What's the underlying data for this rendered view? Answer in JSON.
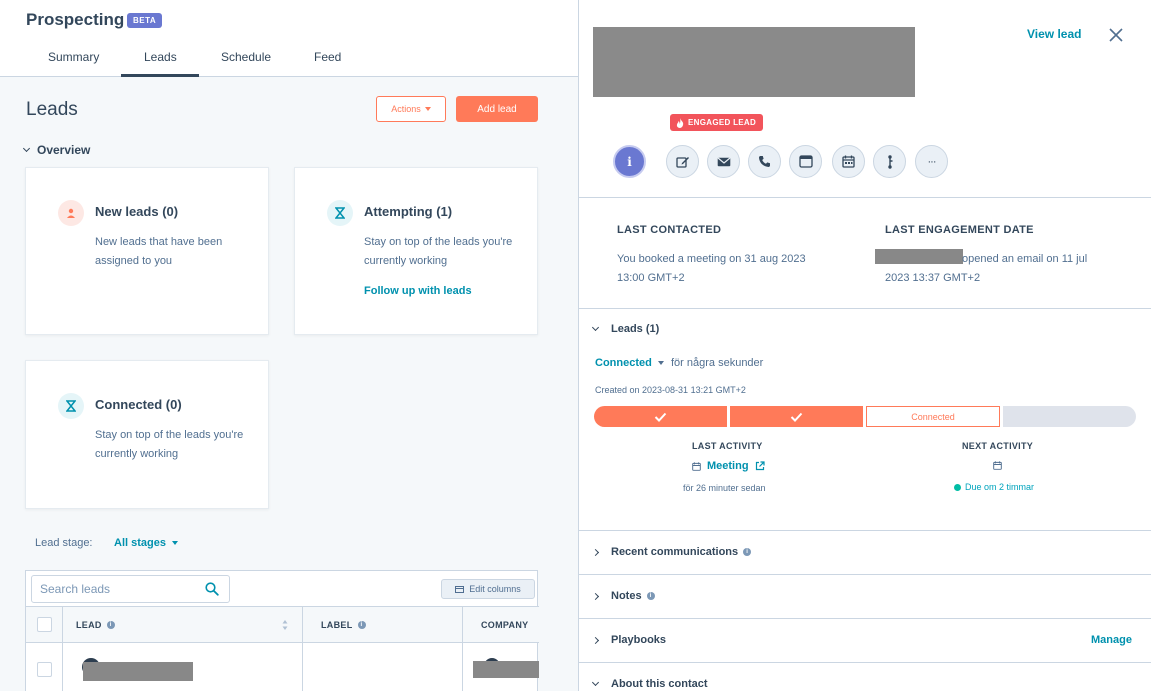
{
  "app": {
    "title": "Prospecting",
    "badge": "BETA"
  },
  "tabs": [
    {
      "label": "Summary"
    },
    {
      "label": "Leads"
    },
    {
      "label": "Schedule"
    },
    {
      "label": "Feed"
    }
  ],
  "leads_page": {
    "heading": "Leads",
    "actions_label": "Actions",
    "add_lead_label": "Add lead",
    "overview_label": "Overview",
    "cards": [
      {
        "title": "New leads (0)",
        "desc": "New leads that have been assigned to you",
        "link": ""
      },
      {
        "title": "Attempting (1)",
        "desc": "Stay on top of the leads you're currently working",
        "link": "Follow up with leads"
      },
      {
        "title": "Connected (0)",
        "desc": "Stay on top of the leads you're currently working",
        "link": ""
      }
    ],
    "lead_stage_label": "Lead stage:",
    "lead_stage_value": "All stages",
    "search_placeholder": "Search leads",
    "edit_columns_label": "Edit columns",
    "columns": {
      "lead": "LEAD",
      "label": "LABEL",
      "company": "COMPANY"
    }
  },
  "panel": {
    "view_lead": "View lead",
    "engaged_badge": "ENGAGED LEAD",
    "info_glyph": "i",
    "more_glyph": "···",
    "last_contacted_label": "LAST CONTACTED",
    "last_contacted_text": "You booked a meeting on 31 aug 2023 13:00 GMT+2",
    "last_engagement_label": "LAST ENGAGEMENT DATE",
    "last_engagement_text_1": "opened an email on 11 jul",
    "last_engagement_text_2": "2023 13:37 GMT+2",
    "leads_section": "Leads (1)",
    "stage": "Connected",
    "stage_time": "för några sekunder",
    "created_on": "Created on 2023-08-31 13:21 GMT+2",
    "stage_bar": [
      {
        "state": "done"
      },
      {
        "state": "done"
      },
      {
        "state": "current",
        "label": "Connected"
      },
      {
        "state": "todo"
      }
    ],
    "last_activity_label": "LAST ACTIVITY",
    "last_activity_name": "Meeting",
    "last_activity_time": "för 26 minuter sedan",
    "next_activity_label": "NEXT ACTIVITY",
    "next_activity_due": "Due om 2 timmar",
    "sections": [
      {
        "label": "Recent communications"
      },
      {
        "label": "Notes"
      },
      {
        "label": "Playbooks"
      },
      {
        "label": "About this contact"
      }
    ],
    "manage_label": "Manage"
  },
  "colors": {
    "accent_orange": "#ff7a59",
    "link_teal": "#0091ae",
    "badge_red": "#f2545b",
    "beta_purple": "#6a78d1"
  },
  "icons": [
    "search-icon",
    "close-icon",
    "flame-icon",
    "info-icon",
    "edit-icon",
    "email-icon",
    "phone-icon",
    "task-icon",
    "calendar-icon",
    "sequence-icon",
    "more-icon",
    "hourglass-icon",
    "person-icon",
    "external-link-icon",
    "checkmark-icon",
    "chevron-down-icon",
    "chevron-right-icon"
  ]
}
